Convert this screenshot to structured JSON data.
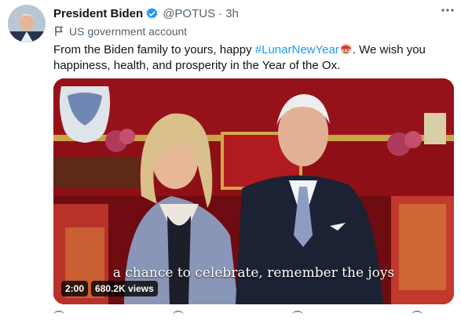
{
  "author": {
    "name": "President Biden",
    "handle": "@POTUS",
    "separator": "·",
    "time": "3h",
    "label": "US government account"
  },
  "tweet": {
    "text_before": "From the Biden family to yours, happy ",
    "hashtag": "#LunarNewYear",
    "text_after": ". We wish you happiness, health, and prosperity in the Year of the Ox."
  },
  "video": {
    "caption": "a chance to celebrate, remember the joys",
    "duration": "2:00",
    "views": "680.2K views"
  },
  "icons": {
    "verified": "verified-badge-icon",
    "label": "flag-icon",
    "more": "more-icon",
    "emoji": "red-envelope-emoji-icon"
  },
  "colors": {
    "accent": "#1d9bf0",
    "muted": "#536471",
    "wall": "#a8161c"
  }
}
